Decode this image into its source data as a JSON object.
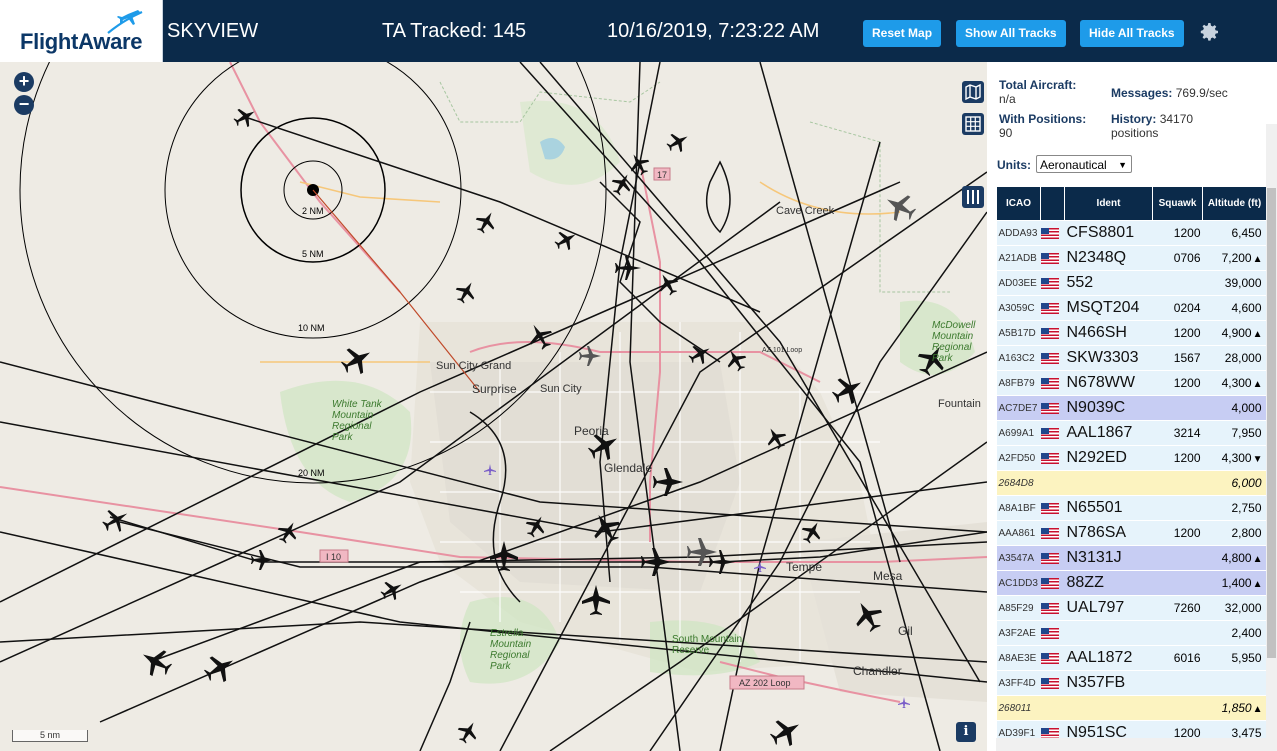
{
  "header": {
    "logo_text": "FlightAware",
    "app_name": "SKYVIEW",
    "tracked": "TA Tracked: 145",
    "datetime": "10/16/2019, 7:23:22 AM",
    "buttons": {
      "reset": "Reset Map",
      "show_all": "Show All Tracks",
      "hide_all": "Hide All Tracks"
    },
    "accent_color": "#1e9be9",
    "bg_color": "#0b2a4a"
  },
  "map": {
    "zoom_in": "+",
    "zoom_out": "−",
    "scale": "5 nm",
    "info": "i",
    "range_rings": [
      "2 NM",
      "5 NM",
      "10 NM",
      "20 NM"
    ],
    "places": {
      "cave_creek": "Cave Creek",
      "sun_city_grand": "Sun City Grand",
      "surprise": "Surprise",
      "sun_city": "Sun City",
      "peoria": "Peoria",
      "glendale": "Glendale",
      "tempe": "Tempe",
      "mesa": "Mesa",
      "gilbert": "Gil",
      "chandler": "Chandler",
      "fountain": "Fountain",
      "white_tank": "White Tank\nMountain\nRegional\nPark",
      "estrella": "Estrella\nMountain\nRegional\nPark",
      "south_mountain": "South Mountain\nReserve",
      "mcdowell": "McDowell\nMountain\nRegional\nPark",
      "loop_202": "AZ 202 Loop",
      "loop_101": "AZ 101 Loop",
      "i10": "I 10",
      "rt17": "17"
    }
  },
  "stats": {
    "total_label": "Total Aircraft:",
    "total_value": "n/a",
    "messages_label": "Messages:",
    "messages_value": "769.9/sec",
    "positions_label": "With Positions:",
    "positions_value": "90",
    "history_label": "History:",
    "history_value": "34170",
    "history_unit": "positions"
  },
  "units": {
    "label": "Units:",
    "selected": "Aeronautical"
  },
  "table": {
    "headers": {
      "icao": "ICAO",
      "ident": "Ident",
      "squawk": "Squawk",
      "altitude": "Altitude (ft)"
    },
    "rows": [
      {
        "icao": "ADDA93",
        "ident": "CFS8801",
        "squawk": "1200",
        "alt": "6,450",
        "dir": "",
        "style": "norm",
        "flag": true
      },
      {
        "icao": "A21ADB",
        "ident": "N2348Q",
        "squawk": "0706",
        "alt": "7,200",
        "dir": "▲",
        "style": "norm",
        "flag": true
      },
      {
        "icao": "AD03EE",
        "ident": "552",
        "squawk": "",
        "alt": "39,000",
        "dir": "",
        "style": "norm",
        "flag": true
      },
      {
        "icao": "A3059C",
        "ident": "MSQT204",
        "squawk": "0204",
        "alt": "4,600",
        "dir": "",
        "style": "norm",
        "flag": true
      },
      {
        "icao": "A5B17D",
        "ident": "N466SH",
        "squawk": "1200",
        "alt": "4,900",
        "dir": "▲",
        "style": "norm",
        "flag": true
      },
      {
        "icao": "A163C2",
        "ident": "SKW3303",
        "squawk": "1567",
        "alt": "28,000",
        "dir": "",
        "style": "norm",
        "flag": true
      },
      {
        "icao": "A8FB79",
        "ident": "N678WW",
        "squawk": "1200",
        "alt": "4,300",
        "dir": "▲",
        "style": "norm",
        "flag": true
      },
      {
        "icao": "AC7DE7",
        "ident": "N9039C",
        "squawk": "",
        "alt": "4,000",
        "dir": "",
        "style": "sel",
        "flag": true
      },
      {
        "icao": "A699A1",
        "ident": "AAL1867",
        "squawk": "3214",
        "alt": "7,950",
        "dir": "",
        "style": "norm",
        "flag": true
      },
      {
        "icao": "A2FD50",
        "ident": "N292ED",
        "squawk": "1200",
        "alt": "4,300",
        "dir": "▼",
        "style": "norm",
        "flag": true
      },
      {
        "icao": "2684D8",
        "ident": "",
        "squawk": "",
        "alt": "6,000",
        "dir": "",
        "style": "mlat",
        "flag": false
      },
      {
        "icao": "A8A1BF",
        "ident": "N65501",
        "squawk": "",
        "alt": "2,750",
        "dir": "",
        "style": "norm",
        "flag": true
      },
      {
        "icao": "AAA861",
        "ident": "N786SA",
        "squawk": "1200",
        "alt": "2,800",
        "dir": "",
        "style": "norm",
        "flag": true
      },
      {
        "icao": "A3547A",
        "ident": "N3131J",
        "squawk": "",
        "alt": "4,800",
        "dir": "▲",
        "style": "sel",
        "flag": true
      },
      {
        "icao": "AC1DD3",
        "ident": "88ZZ",
        "squawk": "",
        "alt": "1,400",
        "dir": "▲",
        "style": "sel",
        "flag": true
      },
      {
        "icao": "A85F29",
        "ident": "UAL797",
        "squawk": "7260",
        "alt": "32,000",
        "dir": "",
        "style": "norm",
        "flag": true
      },
      {
        "icao": "A3F2AE",
        "ident": "",
        "squawk": "",
        "alt": "2,400",
        "dir": "",
        "style": "norm",
        "flag": true
      },
      {
        "icao": "A8AE3E",
        "ident": "AAL1872",
        "squawk": "6016",
        "alt": "5,950",
        "dir": "",
        "style": "norm",
        "flag": true
      },
      {
        "icao": "A3FF4D",
        "ident": "N357FB",
        "squawk": "",
        "alt": "",
        "dir": "",
        "style": "norm",
        "flag": true
      },
      {
        "icao": "268011",
        "ident": "",
        "squawk": "",
        "alt": "1,850",
        "dir": "▲",
        "style": "mlat",
        "flag": false
      },
      {
        "icao": "AD39F1",
        "ident": "N951SC",
        "squawk": "1200",
        "alt": "3,475",
        "dir": "",
        "style": "norm",
        "flag": true
      }
    ]
  }
}
